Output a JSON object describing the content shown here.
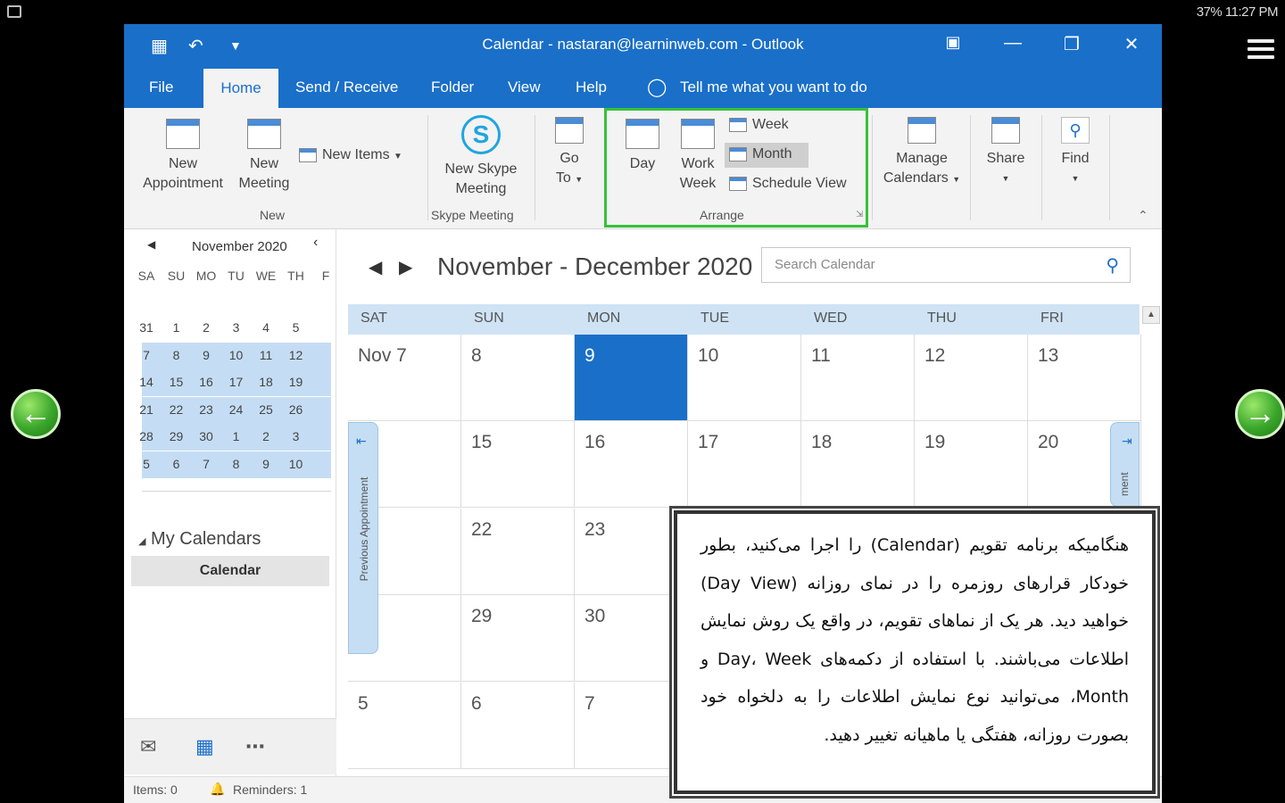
{
  "status_bar": {
    "right_text": "37% 11:27 PM"
  },
  "window": {
    "title": "Calendar - nastaran@learninweb.com  -  Outlook",
    "menu": {
      "file": "File",
      "home": "Home",
      "send_receive": "Send / Receive",
      "folder": "Folder",
      "view": "View",
      "help": "Help",
      "tell_me": "Tell me what you want to do"
    }
  },
  "ribbon": {
    "new_appointment": [
      "New",
      "Appointment"
    ],
    "new_meeting": [
      "New",
      "Meeting"
    ],
    "new_items": "New Items",
    "group_new": "New",
    "new_skype_meeting": [
      "New Skype",
      "Meeting"
    ],
    "group_skype": "Skype Meeting",
    "go_to": [
      "Go",
      "To"
    ],
    "day": "Day",
    "work_week": [
      "Work",
      "Week"
    ],
    "week": "Week",
    "month": "Month",
    "schedule_view": "Schedule View",
    "group_arrange": "Arrange",
    "manage_calendars": [
      "Manage",
      "Calendars"
    ],
    "share": "Share",
    "find": "Find"
  },
  "mini_calendar": {
    "title": "November 2020",
    "dows": [
      "SA",
      "SU",
      "MO",
      "TU",
      "WE",
      "TH",
      "F"
    ],
    "weeks": [
      [
        "31",
        "1",
        "2",
        "3",
        "4",
        "5",
        ""
      ],
      [
        "7",
        "8",
        "9",
        "10",
        "11",
        "12",
        ""
      ],
      [
        "14",
        "15",
        "16",
        "17",
        "18",
        "19",
        ""
      ],
      [
        "21",
        "22",
        "23",
        "24",
        "25",
        "26",
        ""
      ],
      [
        "28",
        "29",
        "30",
        "1",
        "2",
        "3",
        ""
      ],
      [
        "5",
        "6",
        "7",
        "8",
        "9",
        "10",
        ""
      ]
    ]
  },
  "my_calendars": {
    "header": "My Calendars",
    "item": "Calendar"
  },
  "status": {
    "items": "Items: 0",
    "reminders": "Reminders: 1"
  },
  "calendar": {
    "range_title": "November - December 2020",
    "search_placeholder": "Search Calendar",
    "dows": [
      "SAT",
      "SUN",
      "MON",
      "TUE",
      "WED",
      "THU",
      "FRI"
    ],
    "weeks": [
      [
        "Nov 7",
        "8",
        "9",
        "10",
        "11",
        "12",
        "13"
      ],
      [
        "",
        "15",
        "16",
        "17",
        "18",
        "19",
        "20"
      ],
      [
        "",
        "22",
        "23",
        "",
        "",
        "",
        ""
      ],
      [
        "",
        "29",
        "30",
        "",
        "",
        "",
        ""
      ],
      [
        "5",
        "6",
        "7",
        "",
        "",
        "",
        ""
      ]
    ],
    "today": "9",
    "previous_appointment": "Previous Appointment",
    "next_appointment": "ment"
  },
  "note": {
    "text": "هنگامیکه برنامه تقویم (Calendar) را اجرا می‌کنید، بطور خودکار قرارهای روزمره را در نمای روزانه (Day View) خواهید دید. هر یک از نماهای تقویم، در واقع یک روش نمایش اطلاعات می‌باشند. با استفاده از دکمه‌های Day، Week و Month، می‌توانید نوع نمایش اطلاعات را به دلخواه خود بصورت روزانه، هفتگی یا ماهیانه تغییر دهید."
  },
  "colors": {
    "accent": "#1a6fc9",
    "highlight": "#35c23a",
    "week_select": "#c5ddf4"
  }
}
